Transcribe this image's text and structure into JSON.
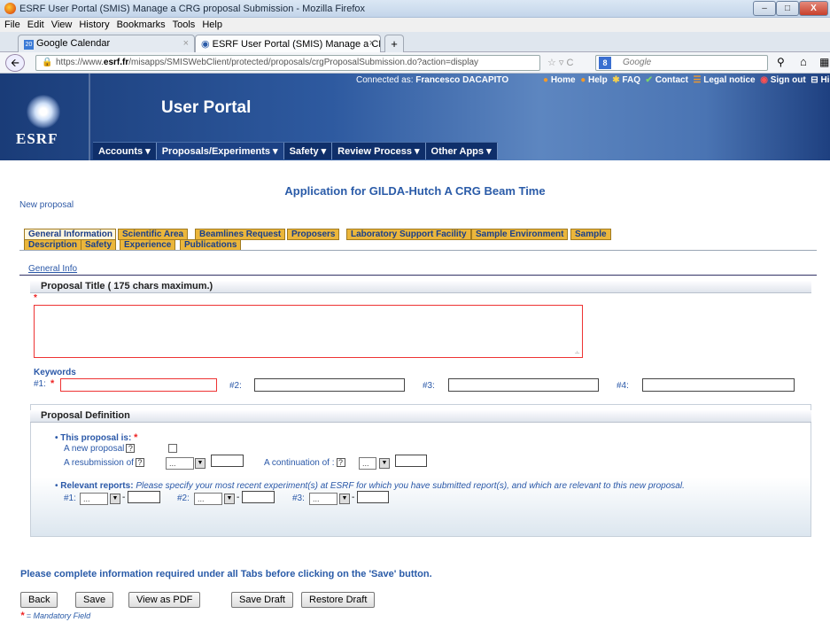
{
  "window": {
    "title": "ESRF User Portal (SMIS) Manage a CRG proposal Submission - Mozilla Firefox",
    "controls": {
      "min": "–",
      "max": "□",
      "close": "X"
    }
  },
  "menubar": [
    "File",
    "Edit",
    "View",
    "History",
    "Bookmarks",
    "Tools",
    "Help"
  ],
  "tabs": [
    {
      "label": "Google Calendar",
      "icon": "calendar-icon",
      "icon_text": "20"
    },
    {
      "label": "ESRF User Portal (SMIS) Manage a CR...",
      "icon": "portal-icon"
    }
  ],
  "tab_close": "×",
  "new_tab": "+",
  "nav": {
    "url_prefix": "https://www.",
    "url_domain": "esrf.fr",
    "url_path": "/misapps/SMISWebClient/protected/proposals/crgProposalSubmission.do?action=display",
    "search_placeholder": "Google",
    "search_engine_glyph": "8"
  },
  "banner": {
    "logo_text": "ESRF",
    "portal_title": "User Portal",
    "connected_label": "Connected as: ",
    "connected_user": "Francesco DACAPITO",
    "links": [
      "Home",
      "Help",
      "FAQ",
      "Contact",
      "Legal notice",
      "Sign out",
      "Hide"
    ],
    "menu": [
      "Accounts",
      "Proposals/Experiments",
      "Safety",
      "Review Process",
      "Other Apps"
    ]
  },
  "page": {
    "app_title": "Application for GILDA-Hutch A CRG Beam Time",
    "new_proposal": "New proposal",
    "tabs_row1": [
      "General Information",
      "Scientific Area",
      "Beamlines Request",
      "Proposers",
      "Laboratory Support Facility",
      "Sample Environment",
      "Sample"
    ],
    "tabs_row2": [
      "Description",
      "Safety",
      "Experience",
      "Publications"
    ],
    "general_info_link": "General Info",
    "title_section": "Proposal Title ( 175 chars maximum.)",
    "required_star": "*",
    "keywords_label": "Keywords",
    "keyword_labels": [
      "#1:",
      "#2:",
      "#3:",
      "#4:"
    ],
    "definition_section": "Proposal Definition",
    "this_proposal_is": "This proposal is:",
    "new_proposal_label": "A new proposal",
    "resubmission_label": "A resubmission of",
    "continuation_label": "A continuation of :",
    "select_placeholder": "...",
    "relevant_reports_label": "Relevant reports:",
    "relevant_reports_text": "Please specify your most recent experiment(s) at ESRF for which you have submitted report(s), and which are relevant to this new proposal.",
    "report_labels": [
      "#1:",
      "#2:",
      "#3:"
    ],
    "instruction": "Please complete information required under all Tabs before clicking on the 'Save' button.",
    "buttons": [
      "Back",
      "Save",
      "View as PDF",
      "Save Draft",
      "Restore Draft"
    ],
    "mandatory_note": "= Mandatory Field"
  },
  "colors": {
    "accent": "#2a5ba8",
    "tab_orange": "#ebb63b",
    "required_red": "#e22222",
    "menu_dark": "#0f2f6a"
  }
}
